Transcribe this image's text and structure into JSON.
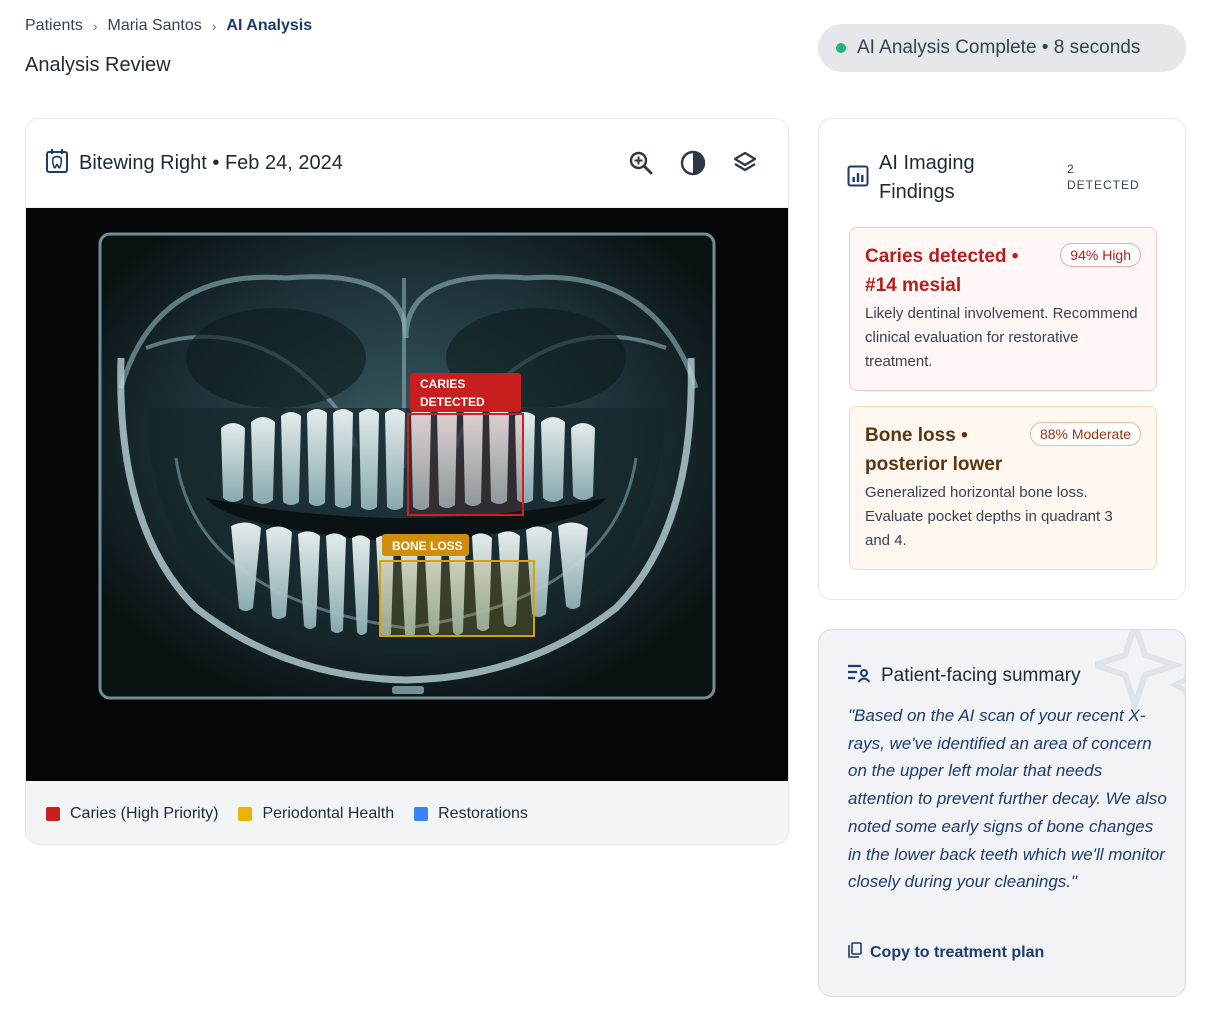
{
  "breadcrumb": {
    "items": [
      "Patients",
      "Maria Santos"
    ],
    "active": "AI Analysis",
    "separator": "›"
  },
  "page": {
    "title": "Analysis Review"
  },
  "status": {
    "text": "AI Analysis Complete • 8 seconds",
    "color": "#22b573"
  },
  "image_card": {
    "title": "Bitewing Right • Feb 24, 2024",
    "tools": [
      "zoom-in-icon",
      "contrast-icon",
      "layers-icon"
    ],
    "annotations": {
      "caries_label_line1": "CARIES",
      "caries_label_line2": "DETECTED",
      "bone_label": "BONE LOSS"
    },
    "legend": [
      {
        "label": "Caries (High Priority)",
        "color": "#c81e1e"
      },
      {
        "label": "Periodontal Health",
        "color": "#eab308"
      },
      {
        "label": "Restorations",
        "color": "#3b82f6"
      }
    ]
  },
  "findings": {
    "title": "AI Imaging Findings",
    "count_number": "2",
    "count_label": "DETECTED",
    "items": [
      {
        "title": "Caries detected • #14 mesial",
        "badge": "94% High",
        "description": "Likely dentinal involvement. Recommend clinical evaluation for restorative treatment."
      },
      {
        "title": "Bone loss • posterior lower",
        "badge": "88% Moderate",
        "description": "Generalized horizontal bone loss. Evaluate pocket depths in quadrant 3 and 4."
      }
    ]
  },
  "summary": {
    "title": "Patient-facing summary",
    "text": "\"Based on the AI scan of your recent X-rays, we've identified an area of concern on the upper left molar that needs attention to prevent further decay. We also noted some early signs of bone changes in the lower back teeth which we'll monitor closely during your cleanings.\"",
    "copy_label": "Copy to treatment plan"
  },
  "colors": {
    "accent_navy": "#1e3a6e",
    "caries_red": "#c81e1e",
    "bone_gold": "#d4a017"
  }
}
